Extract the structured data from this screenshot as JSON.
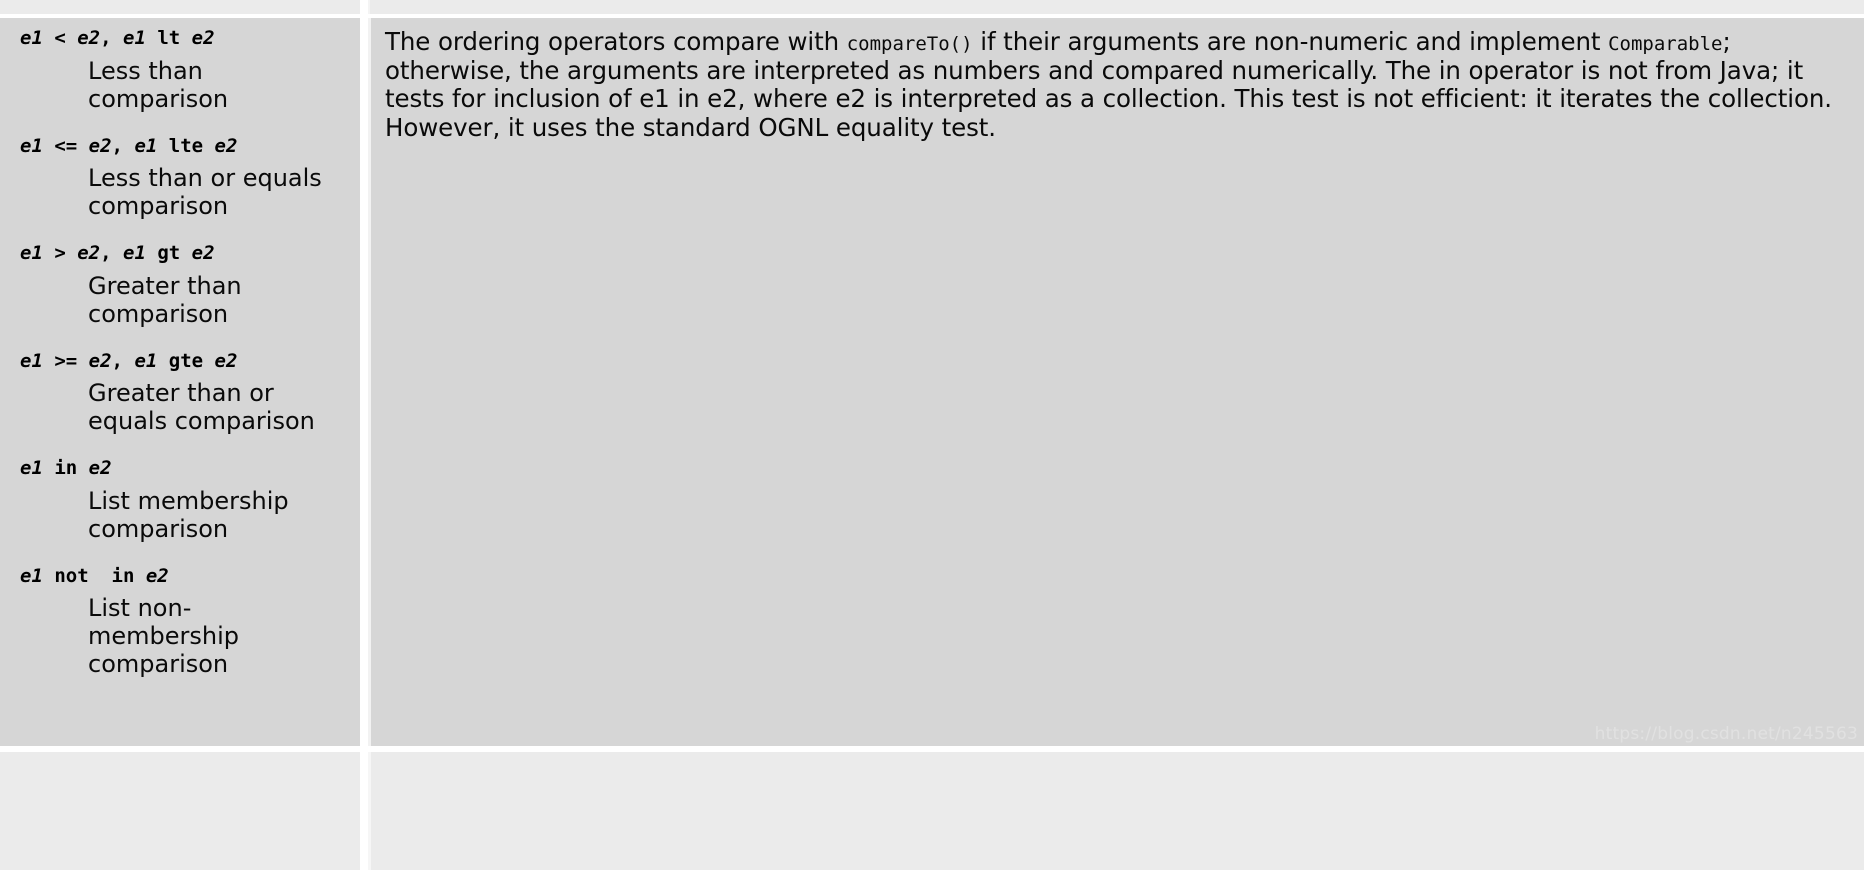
{
  "document": {
    "type": "reference-table",
    "colors": {
      "row_background": "#d6d6d6",
      "alt_row_background": "#ebebeb",
      "page_background": "#ffffff",
      "text": "#0a0a0a",
      "watermark": "#e2e2e2"
    }
  },
  "terms_column": {
    "entries": [
      {
        "term_parts": [
          {
            "text": "e1",
            "style": "var"
          },
          {
            "text": " < ",
            "style": "op"
          },
          {
            "text": "e2",
            "style": "var"
          },
          {
            "text": ", ",
            "style": "op"
          },
          {
            "text": "e1",
            "style": "var"
          },
          {
            "text": " lt ",
            "style": "op"
          },
          {
            "text": "e2",
            "style": "var"
          }
        ],
        "term_text": "e1 < e2, e1 lt e2",
        "definition": "Less than comparison"
      },
      {
        "term_parts": [
          {
            "text": "e1",
            "style": "var"
          },
          {
            "text": " <= ",
            "style": "op"
          },
          {
            "text": "e2",
            "style": "var"
          },
          {
            "text": ", ",
            "style": "op"
          },
          {
            "text": "e1",
            "style": "var"
          },
          {
            "text": " lte ",
            "style": "op"
          },
          {
            "text": "e2",
            "style": "var"
          }
        ],
        "term_text": "e1 <= e2, e1 lte e2",
        "definition": "Less than or equals comparison"
      },
      {
        "term_parts": [
          {
            "text": "e1",
            "style": "var"
          },
          {
            "text": " > ",
            "style": "op"
          },
          {
            "text": "e2",
            "style": "var"
          },
          {
            "text": ", ",
            "style": "op"
          },
          {
            "text": "e1",
            "style": "var"
          },
          {
            "text": " gt ",
            "style": "op"
          },
          {
            "text": "e2",
            "style": "var"
          }
        ],
        "term_text": "e1 > e2, e1 gt e2",
        "definition": "Greater than comparison"
      },
      {
        "term_parts": [
          {
            "text": "e1",
            "style": "var"
          },
          {
            "text": " >= ",
            "style": "op"
          },
          {
            "text": "e2",
            "style": "var"
          },
          {
            "text": ", ",
            "style": "op"
          },
          {
            "text": "e1",
            "style": "var"
          },
          {
            "text": " gte ",
            "style": "op"
          },
          {
            "text": "e2",
            "style": "var"
          }
        ],
        "term_text": "e1 >= e2, e1 gte e2",
        "definition": "Greater than or equals comparison"
      },
      {
        "term_parts": [
          {
            "text": "e1",
            "style": "var"
          },
          {
            "text": " in ",
            "style": "op"
          },
          {
            "text": "e2",
            "style": "var"
          }
        ],
        "term_text": "e1 in e2",
        "definition": "List membership comparison"
      },
      {
        "term_parts": [
          {
            "text": "e1",
            "style": "var"
          },
          {
            "text": " not  in ",
            "style": "op"
          },
          {
            "text": "e2",
            "style": "var"
          }
        ],
        "term_text": "e1 not  in e2",
        "definition": "List non-membership comparison"
      }
    ]
  },
  "description_column": {
    "paragraph_parts": [
      {
        "text": "The ordering operators compare with ",
        "style": "normal"
      },
      {
        "text": "compareTo()",
        "style": "code"
      },
      {
        "text": " if their arguments are non-numeric and implement ",
        "style": "normal"
      },
      {
        "text": "Comparable",
        "style": "code"
      },
      {
        "text": "; otherwise, the arguments are interpreted as numbers and compared numerically. The in operator is not from Java; it tests for inclusion of e1 in e2, where e2 is interpreted as a collection. This test is not efficient: it iterates the collection. However, it uses the standard OGNL equality test.",
        "style": "normal"
      }
    ],
    "paragraph_text": "The ordering operators compare with compareTo() if their arguments are non-numeric and implement Comparable; otherwise, the arguments are interpreted as numbers and compared numerically. The in operator is not from Java; it tests for inclusion of e1 in e2, where e2 is interpreted as a collection. This test is not efficient: it iterates the collection. However, it uses the standard OGNL equality test."
  },
  "watermark": {
    "text": "https://blog.csdn.net/n245563"
  }
}
